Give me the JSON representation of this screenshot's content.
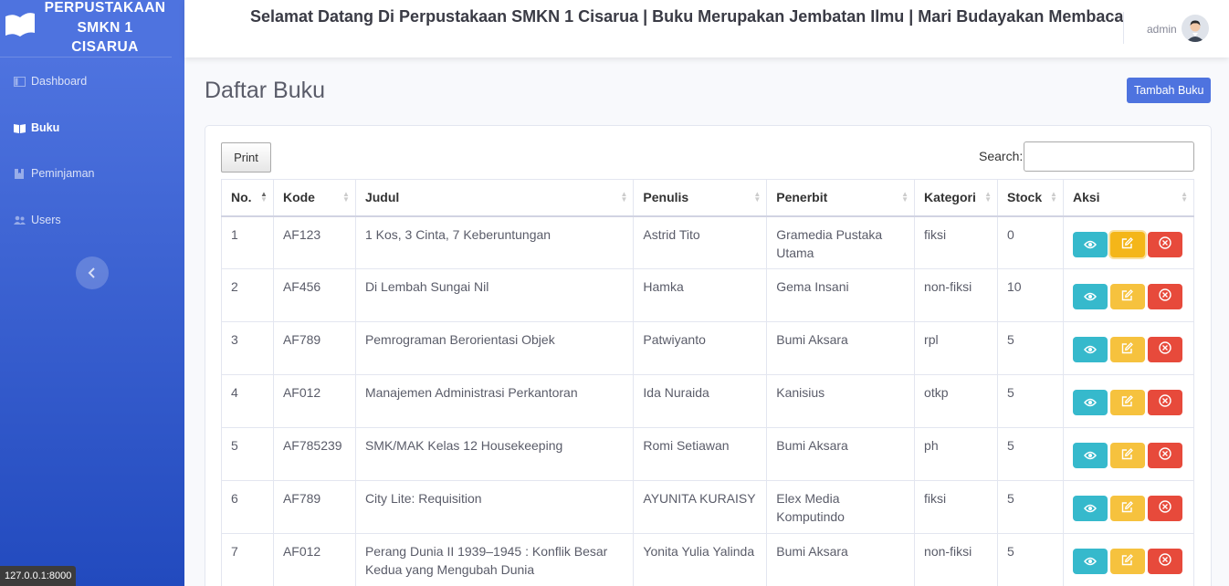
{
  "brand": {
    "line1": "PERPUSTAKAAN",
    "line2": "SMKN 1",
    "line3": "CISARUA",
    "icon": "book-icon"
  },
  "sidebar": {
    "items": [
      {
        "label": "Dashboard",
        "icon": "dashboard-icon"
      },
      {
        "label": "Buku",
        "icon": "book-open-icon",
        "active": true
      },
      {
        "label": "Peminjaman",
        "icon": "bookmark-icon"
      },
      {
        "label": "Users",
        "icon": "users-icon"
      }
    ]
  },
  "topbar": {
    "marquee": "Selamat Datang Di Perpustakaan SMKN 1 Cisarua | Buku Merupakan Jembatan Ilmu | Mari Budayakan Membaca",
    "user": "admin"
  },
  "page": {
    "title": "Daftar Buku",
    "add_button": "Tambah Buku"
  },
  "controls": {
    "print": "Print",
    "search_label": "Search:",
    "search_value": ""
  },
  "table": {
    "headers": [
      "No.",
      "Kode",
      "Judul",
      "Penulis",
      "Penerbit",
      "Kategori",
      "Stock",
      "Aksi"
    ],
    "rows": [
      {
        "no": "1",
        "kode": "AF123",
        "judul": "1 Kos, 3 Cinta, 7 Keberuntungan",
        "penulis": "Astrid Tito",
        "penerbit": "Gramedia Pustaka Utama",
        "kategori": "fiksi",
        "stock": "0"
      },
      {
        "no": "2",
        "kode": "AF456",
        "judul": "Di Lembah Sungai Nil",
        "penulis": "Hamka",
        "penerbit": "Gema Insani",
        "kategori": "non-fiksi",
        "stock": "10"
      },
      {
        "no": "3",
        "kode": "AF789",
        "judul": "Pemrograman Berorientasi Objek",
        "penulis": "Patwiyanto",
        "penerbit": "Bumi Aksara",
        "kategori": "rpl",
        "stock": "5"
      },
      {
        "no": "4",
        "kode": "AF012",
        "judul": "Manajemen Administrasi Perkantoran",
        "penulis": "Ida Nuraida",
        "penerbit": "Kanisius",
        "kategori": "otkp",
        "stock": "5"
      },
      {
        "no": "5",
        "kode": "AF785239",
        "judul": "SMK/MAK Kelas 12 Housekeeping",
        "penulis": "Romi Setiawan",
        "penerbit": "Bumi Aksara",
        "kategori": "ph",
        "stock": "5"
      },
      {
        "no": "6",
        "kode": "AF789",
        "judul": "City Lite: Requisition",
        "penulis": "AYUNITA KURAISY",
        "penerbit": "Elex Media Komputindo",
        "kategori": "fiksi",
        "stock": "5"
      },
      {
        "no": "7",
        "kode": "AF012",
        "judul": "Perang Dunia II 1939–1945 : Konflik Besar Kedua yang Mengubah Dunia",
        "penulis": "Yonita Yulia Yalinda",
        "penerbit": "Bumi Aksara",
        "kategori": "non-fiksi",
        "stock": "5"
      }
    ]
  },
  "status_bar": "127.0.0.1:8000",
  "colors": {
    "primary": "#4e73df",
    "info": "#36b9cc",
    "warning": "#f6c23e",
    "danger": "#e74a3b"
  }
}
